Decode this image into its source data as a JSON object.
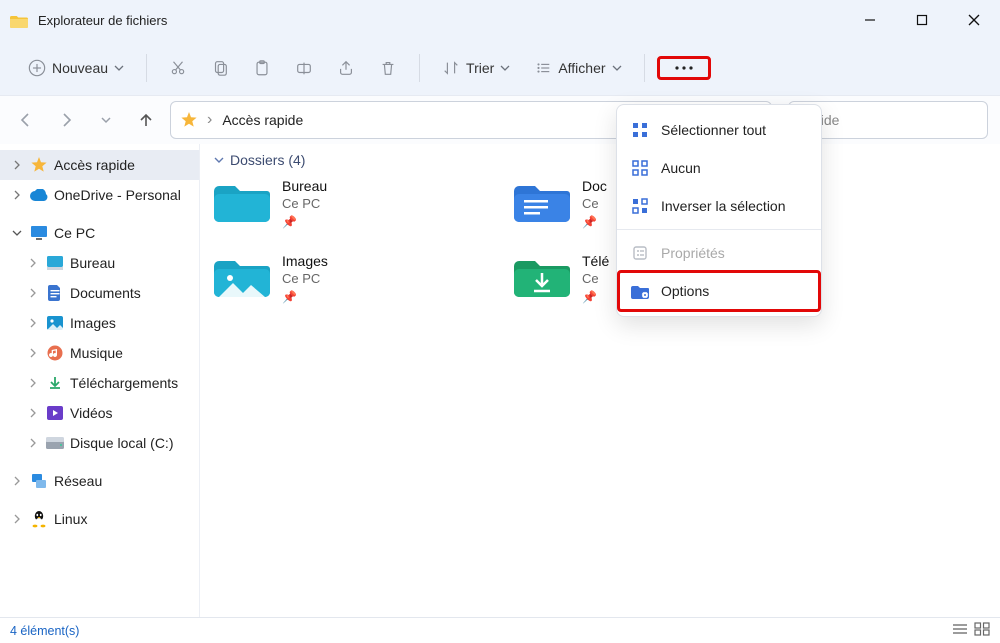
{
  "window": {
    "title": "Explorateur de fichiers"
  },
  "toolbar": {
    "new": "Nouveau",
    "sort": "Trier",
    "view": "Afficher"
  },
  "nav": {
    "current_path": "Accès rapide",
    "separator": "›"
  },
  "search": {
    "placeholder_suffix": "pide"
  },
  "sidebar": {
    "quick_access": "Accès rapide",
    "onedrive": "OneDrive - Personal",
    "this_pc": "Ce PC",
    "desktop": "Bureau",
    "documents": "Documents",
    "pictures": "Images",
    "music": "Musique",
    "downloads": "Téléchargements",
    "videos": "Vidéos",
    "local_disk": "Disque local (C:)",
    "network": "Réseau",
    "linux": "Linux"
  },
  "content": {
    "section_label": "Dossiers (4)",
    "items": [
      {
        "name": "Bureau",
        "loc": "Ce PC",
        "color": "#1aa3c4"
      },
      {
        "name": "Documents",
        "loc": "Ce PC",
        "color": "#2e75d6",
        "truncated": "Doc"
      },
      {
        "name": "Images",
        "loc": "Ce PC",
        "color": "#1aa3c4"
      },
      {
        "name": "Téléchargements",
        "loc": "Ce PC",
        "color": "#1aa86f",
        "truncated": "Télé"
      }
    ]
  },
  "menu": {
    "select_all": "Sélectionner tout",
    "none": "Aucun",
    "invert": "Inverser la sélection",
    "properties": "Propriétés",
    "options": "Options"
  },
  "statusbar": {
    "count_label": "4 élément(s)"
  }
}
